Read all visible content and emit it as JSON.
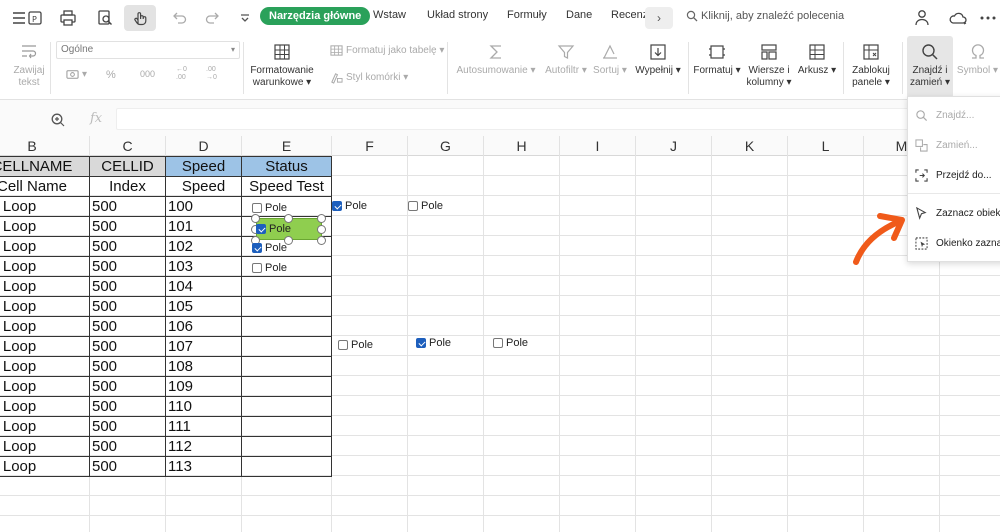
{
  "menubar": {
    "tabs": {
      "home": "Narzędzia główne",
      "insert": "Wstaw",
      "layout": "Układ strony",
      "formulas": "Formuły",
      "data": "Dane",
      "review": "Recenz"
    },
    "more_tabs_glyph": "›",
    "search_placeholder": "Kliknij, aby znaleźć polecenia"
  },
  "ribbon": {
    "wrap_text": "Zawijaj\ntekst",
    "number_format": "Ogólne",
    "percent_glyph": "%",
    "thousands_glyph": "000",
    "inc_dec_left": "←0\n.00",
    "inc_dec_right": ".00\n→0",
    "conditional_formatting": "Formatowanie\nwarunkowe ▾",
    "format_as_table": "Formatuj jako tabelę ▾",
    "cell_style": "Styl komórki ▾",
    "autosum": "Autosumowanie ▾",
    "autofilter": "Autofiltr ▾",
    "sort": "Sortuj ▾",
    "fill": "Wypełnij ▾",
    "format": "Formatuj ▾",
    "rows_cols": "Wiersze i\nkolumny ▾",
    "sheet": "Arkusz ▾",
    "freeze": "Zablokuj\npanele ▾",
    "find": "Znajdź i\nzamień ▾",
    "symbol": "Symbol ▾"
  },
  "formula_bar": {
    "fx": "fx",
    "value": ""
  },
  "columns": [
    "B",
    "C",
    "D",
    "E",
    "F",
    "G",
    "H",
    "I",
    "J",
    "K",
    "L",
    "M"
  ],
  "table": {
    "header1": [
      "CELLNAME",
      "CELLID",
      "Speed",
      "Status"
    ],
    "header2": [
      "Cell Name",
      "Index",
      "Speed",
      "Speed Test"
    ],
    "rows": [
      [
        "per Loop",
        "500",
        "100"
      ],
      [
        "per Loop",
        "500",
        "101"
      ],
      [
        "per Loop",
        "500",
        "102"
      ],
      [
        "per Loop",
        "500",
        "103"
      ],
      [
        "per Loop",
        "500",
        "104"
      ],
      [
        "per Loop",
        "500",
        "105"
      ],
      [
        "per Loop",
        "500",
        "106"
      ],
      [
        "per Loop",
        "500",
        "107"
      ],
      [
        "per Loop",
        "500",
        "108"
      ],
      [
        "per Loop",
        "500",
        "109"
      ],
      [
        "per Loop",
        "500",
        "110"
      ],
      [
        "per Loop",
        "500",
        "111"
      ],
      [
        "per Loop",
        "500",
        "112"
      ],
      [
        "per Loop",
        "500",
        "113"
      ]
    ]
  },
  "checkboxes": [
    {
      "label": "Pole",
      "checked": false
    },
    {
      "label": "Pole",
      "checked": true
    },
    {
      "label": "Pole",
      "checked": true
    },
    {
      "label": "Pole",
      "checked": false
    },
    {
      "label": "Pole",
      "checked": true
    },
    {
      "label": "Pole",
      "checked": false
    },
    {
      "label": "Pole",
      "checked": false
    },
    {
      "label": "Pole",
      "checked": true
    },
    {
      "label": "Pole",
      "checked": false
    }
  ],
  "dropdown": {
    "find": "Znajdź...",
    "replace": "Zamień...",
    "goto": "Przejdź do...",
    "select_objects": "Zaznacz obiekty",
    "selection_pane": "Okienko zaznaczenia"
  },
  "colors": {
    "accent_green": "#2aa15a",
    "header_blue": "#9dc3e6",
    "header_grey": "#d9d9d9",
    "selected_checkbox_fill": "#8fce4f",
    "arrow_orange": "#f05a1a"
  }
}
